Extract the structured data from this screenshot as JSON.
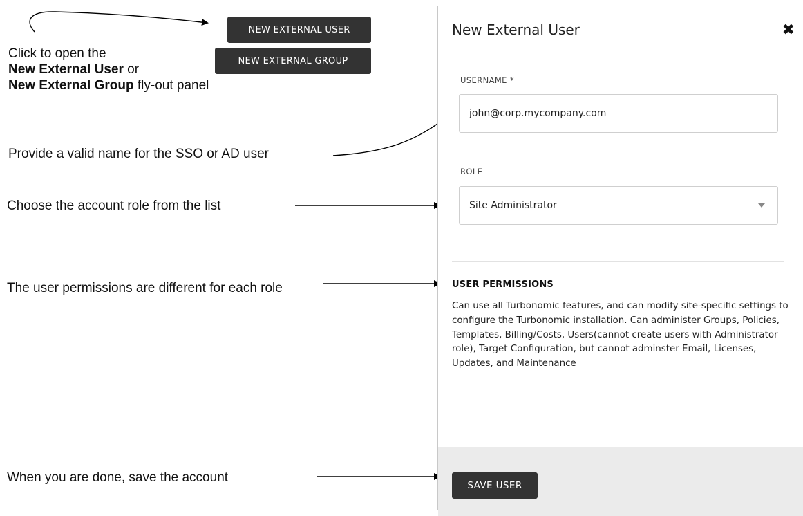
{
  "buttons": {
    "new_external_user": "NEW EXTERNAL USER",
    "new_external_group": "NEW EXTERNAL GROUP"
  },
  "annotations": {
    "open_panel": {
      "line1": "Click to open the",
      "user_bold": "New External User",
      "or": " or",
      "group_bold": "New External Group",
      "suffix": " fly-out panel"
    },
    "username_hint": "Provide a valid name for the SSO or AD user",
    "role_hint": "Choose the account role from the list",
    "permissions_hint": "The user permissions are different for each role",
    "save_hint": "When you are done, save the account"
  },
  "panel": {
    "title": "New External User",
    "close_icon": "close-icon",
    "username_label": "USERNAME *",
    "username_value": "john@corp.mycompany.com",
    "role_label": "ROLE",
    "role_value": "Site Administrator",
    "permissions_title": "USER PERMISSIONS",
    "permissions_text": "Can use all Turbonomic features, and can modify site-specific settings to configure the Turbonomic installation. Can administer Groups, Policies, Templates, Billing/Costs, Users(cannot create users with Administrator role), Target Configuration, but cannot adminster Email, Licenses, Updates, and Maintenance",
    "save_button": "SAVE USER"
  },
  "colors": {
    "button_dark": "#333333",
    "footer_bg": "#ebebeb",
    "border": "#cfcfcf"
  }
}
